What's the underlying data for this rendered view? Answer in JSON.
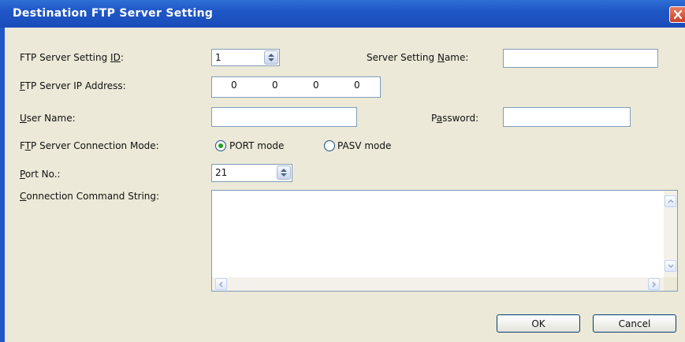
{
  "window": {
    "title": "Destination FTP Server Setting"
  },
  "form": {
    "server_id_label_pre": "FTP Server Setting ",
    "server_id_label_acc": "ID",
    "server_id_label_post": ":",
    "server_id_value": "1",
    "server_name_label_pre": "Server Setting ",
    "server_name_label_acc": "N",
    "server_name_label_post": "ame:",
    "server_name_value": "",
    "ip_label_acc": "F",
    "ip_label_post": "TP Server IP Address:",
    "ip_octets": [
      "0",
      "0",
      "0",
      "0"
    ],
    "user_label_acc": "U",
    "user_label_post": "ser Name:",
    "user_value": "",
    "password_label_pre": "P",
    "password_label_acc": "a",
    "password_label_post": "ssword:",
    "password_value": "",
    "mode_label_pre": "F",
    "mode_label_acc": "T",
    "mode_label_post": "P Server Connection Mode:",
    "mode_options": [
      "PORT mode",
      "PASV mode"
    ],
    "mode_selected": "PORT mode",
    "port_label_acc": "P",
    "port_label_post": "ort No.:",
    "port_value": "21",
    "command_label_acc": "C",
    "command_label_post": "onnection Command String:",
    "command_value": ""
  },
  "buttons": {
    "ok": "OK",
    "cancel": "Cancel"
  }
}
